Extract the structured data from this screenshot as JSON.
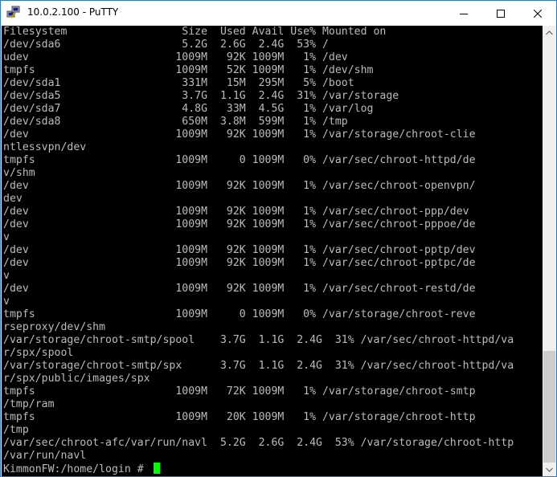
{
  "window": {
    "title": "10.0.2.100 - PuTTY",
    "app_icon": "putty-computers-icon"
  },
  "controls": {
    "minimize_icon": "minimize-icon",
    "maximize_icon": "maximize-icon",
    "close_icon": "close-icon"
  },
  "terminal": {
    "background": "#000000",
    "foreground": "#bbbbbb",
    "cursor_color": "#00ff00",
    "lines": [
      "Filesystem                  Size  Used Avail Use% Mounted on",
      "/dev/sda6                   5.2G  2.6G  2.4G  53% /",
      "udev                       1009M   92K 1009M   1% /dev",
      "tmpfs                      1009M   52K 1009M   1% /dev/shm",
      "/dev/sda1                   331M   15M  295M   5% /boot",
      "/dev/sda5                   3.7G  1.1G  2.4G  31% /var/storage",
      "/dev/sda7                   4.8G   33M  4.5G   1% /var/log",
      "/dev/sda8                   650M  3.8M  599M   1% /tmp",
      "/dev                       1009M   92K 1009M   1% /var/storage/chroot-clie",
      "ntlessvpn/dev",
      "tmpfs                      1009M     0 1009M   0% /var/sec/chroot-httpd/de",
      "v/shm",
      "/dev                       1009M   92K 1009M   1% /var/sec/chroot-openvpn/",
      "dev",
      "/dev                       1009M   92K 1009M   1% /var/sec/chroot-ppp/dev",
      "/dev                       1009M   92K 1009M   1% /var/sec/chroot-pppoe/de",
      "v",
      "/dev                       1009M   92K 1009M   1% /var/sec/chroot-pptp/dev",
      "/dev                       1009M   92K 1009M   1% /var/sec/chroot-pptpc/de",
      "v",
      "/dev                       1009M   92K 1009M   1% /var/sec/chroot-restd/de",
      "v",
      "tmpfs                      1009M     0 1009M   0% /var/storage/chroot-reve",
      "rseproxy/dev/shm",
      "/var/storage/chroot-smtp/spool    3.7G  1.1G  2.4G  31% /var/sec/chroot-httpd/va",
      "r/spx/spool",
      "/var/storage/chroot-smtp/spx      3.7G  1.1G  2.4G  31% /var/sec/chroot-httpd/va",
      "r/spx/public/images/spx",
      "tmpfs                      1009M   72K 1009M   1% /var/storage/chroot-smtp",
      "/tmp/ram",
      "tmpfs                      1009M   20K 1009M   1% /var/storage/chroot-http",
      "/tmp",
      "/var/sec/chroot-afc/var/run/navl  5.2G  2.6G  2.4G  53% /var/storage/chroot-http",
      "/var/run/navl"
    ],
    "prompt": "KimmonFW:/home/login # "
  },
  "scrollbar": {
    "up_icon": "scroll-up-arrow-icon",
    "down_icon": "scroll-down-arrow-icon"
  }
}
